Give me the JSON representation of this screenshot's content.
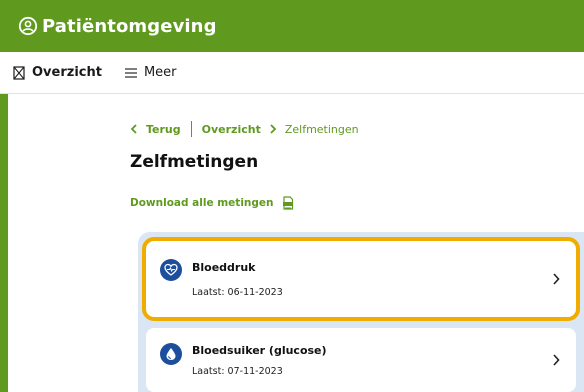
{
  "header": {
    "title": "Patiëntomgeving",
    "icon": "user-circle-icon"
  },
  "nav": {
    "items": [
      {
        "label": "Overzicht",
        "icon": "hourglass-icon",
        "active": true
      },
      {
        "label": "Meer",
        "icon": "menu-icon",
        "active": false
      }
    ]
  },
  "breadcrumb": {
    "back_label": "Terug",
    "items": [
      "Overzicht",
      "Zelfmetingen"
    ]
  },
  "page": {
    "title": "Zelfmetingen",
    "download_label": "Download alle metingen",
    "download_icon": "pdf-download-icon"
  },
  "measurements": [
    {
      "title": "Bloeddruk",
      "last": "Laatst: 06-11-2023",
      "icon": "heart-pulse-icon",
      "highlighted": true
    },
    {
      "title": "Bloedsuiker (glucose)",
      "last": "Laatst: 07-11-2023",
      "icon": "blood-drop-icon",
      "highlighted": false
    }
  ],
  "colors": {
    "brand_green": "#5f9a1f",
    "highlight": "#f0ad00",
    "icon_blue": "#1d4e9e",
    "panel_blue": "#dbe6f5"
  }
}
